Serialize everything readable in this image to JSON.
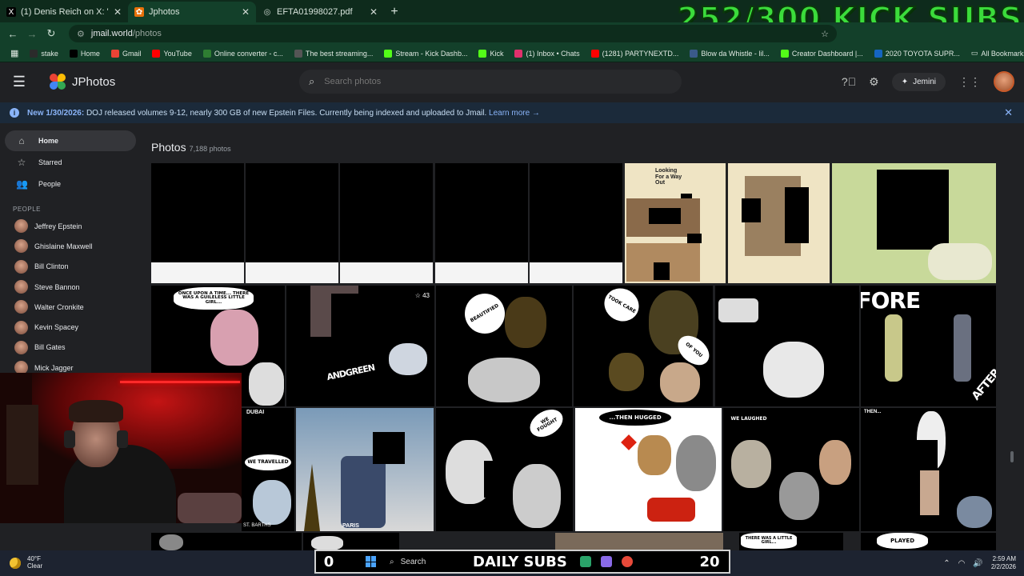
{
  "browser": {
    "tabs": [
      {
        "title": "(1) Denis Reich on X: \"@IntCyb",
        "icon": "x-logo-icon",
        "active": false
      },
      {
        "title": "Jphotos",
        "icon": "jphotos-icon",
        "active": true
      },
      {
        "title": "EFTA01998027.pdf",
        "icon": "globe-icon",
        "active": false
      }
    ],
    "new_tab": "+",
    "url_host": "jmail.world",
    "url_path": "/photos",
    "bookmarks": [
      {
        "label": "stake",
        "color": "#2b2b2b"
      },
      {
        "label": "Home",
        "color": "#000000"
      },
      {
        "label": "Gmail",
        "color": "#ea4335"
      },
      {
        "label": "YouTube",
        "color": "#ff0000"
      },
      {
        "label": "Online converter - c...",
        "color": "#2e7d32"
      },
      {
        "label": "The best streaming...",
        "color": "#555555"
      },
      {
        "label": "Stream - Kick Dashb...",
        "color": "#53fc18"
      },
      {
        "label": "Kick",
        "color": "#53fc18"
      },
      {
        "label": "(1) Inbox • Chats",
        "color": "#e1306c"
      },
      {
        "label": "(1281) PARTYNEXTD...",
        "color": "#ff0000"
      },
      {
        "label": "Blow da Whistle - lil...",
        "color": "#3a5a8a"
      },
      {
        "label": "Creator Dashboard |...",
        "color": "#53fc18"
      },
      {
        "label": "2020 TOYOTA SUPR...",
        "color": "#1565c0"
      }
    ],
    "all_bookmarks": "All Bookmarks"
  },
  "overlay": {
    "kick_subs": "252/300 KICK SUBS",
    "daily_left": "0",
    "daily_label": "DAILY SUBS",
    "daily_right": "20"
  },
  "app": {
    "name": "JPhotos",
    "search_placeholder": "Search photos",
    "gemini_label": "Jemini",
    "banner": {
      "lead": "New 1/30/2026:",
      "text": " DOJ released volumes 9-12, nearly 300 GB of new Epstein Files. Currently being indexed and uploaded to Jmail. ",
      "link": "Learn more →"
    }
  },
  "sidebar": {
    "nav": [
      {
        "label": "Home",
        "icon": "home-icon",
        "active": true
      },
      {
        "label": "Starred",
        "icon": "star-icon",
        "active": false
      },
      {
        "label": "People",
        "icon": "people-icon",
        "active": false
      }
    ],
    "people_header": "PEOPLE",
    "people": [
      "Jeffrey Epstein",
      "Ghislaine Maxwell",
      "Bill Clinton",
      "Steve Bannon",
      "Walter Cronkite",
      "Kevin Spacey",
      "Bill Gates",
      "Mick Jagger"
    ]
  },
  "main": {
    "title": "Photos",
    "count": "7,188 photos",
    "tile_texts": {
      "scrapbook": "Looking For a Way Out",
      "once": "ONCE UPON A TIME... THERE WAS A GUILELESS LITTLE GIRL...",
      "andgreen": "ANDGREEN",
      "star_count": "43",
      "beautified": "BEAUTIFIED",
      "tookcare": "TOOK CARE",
      "ofyou": "OF YOU",
      "before": "BEFORE",
      "after": "AFTER",
      "dubai": "DUBAI",
      "travelled": "WE TRAVELLED",
      "paris": "PARIS",
      "stbarths": "ST. BARTHS",
      "fought": "WE FOUGHT",
      "hugged": "...THEN HUGGED",
      "laughed": "WE LAUGHED",
      "then": "THEN...",
      "played": "PLAYED",
      "girl2": "THERE WAS A LITTLE GIRL..."
    }
  },
  "taskbar": {
    "temp": "40°F",
    "condition": "Clear",
    "search": "Search",
    "time": "2:59 AM",
    "date": "2/2/2026"
  }
}
